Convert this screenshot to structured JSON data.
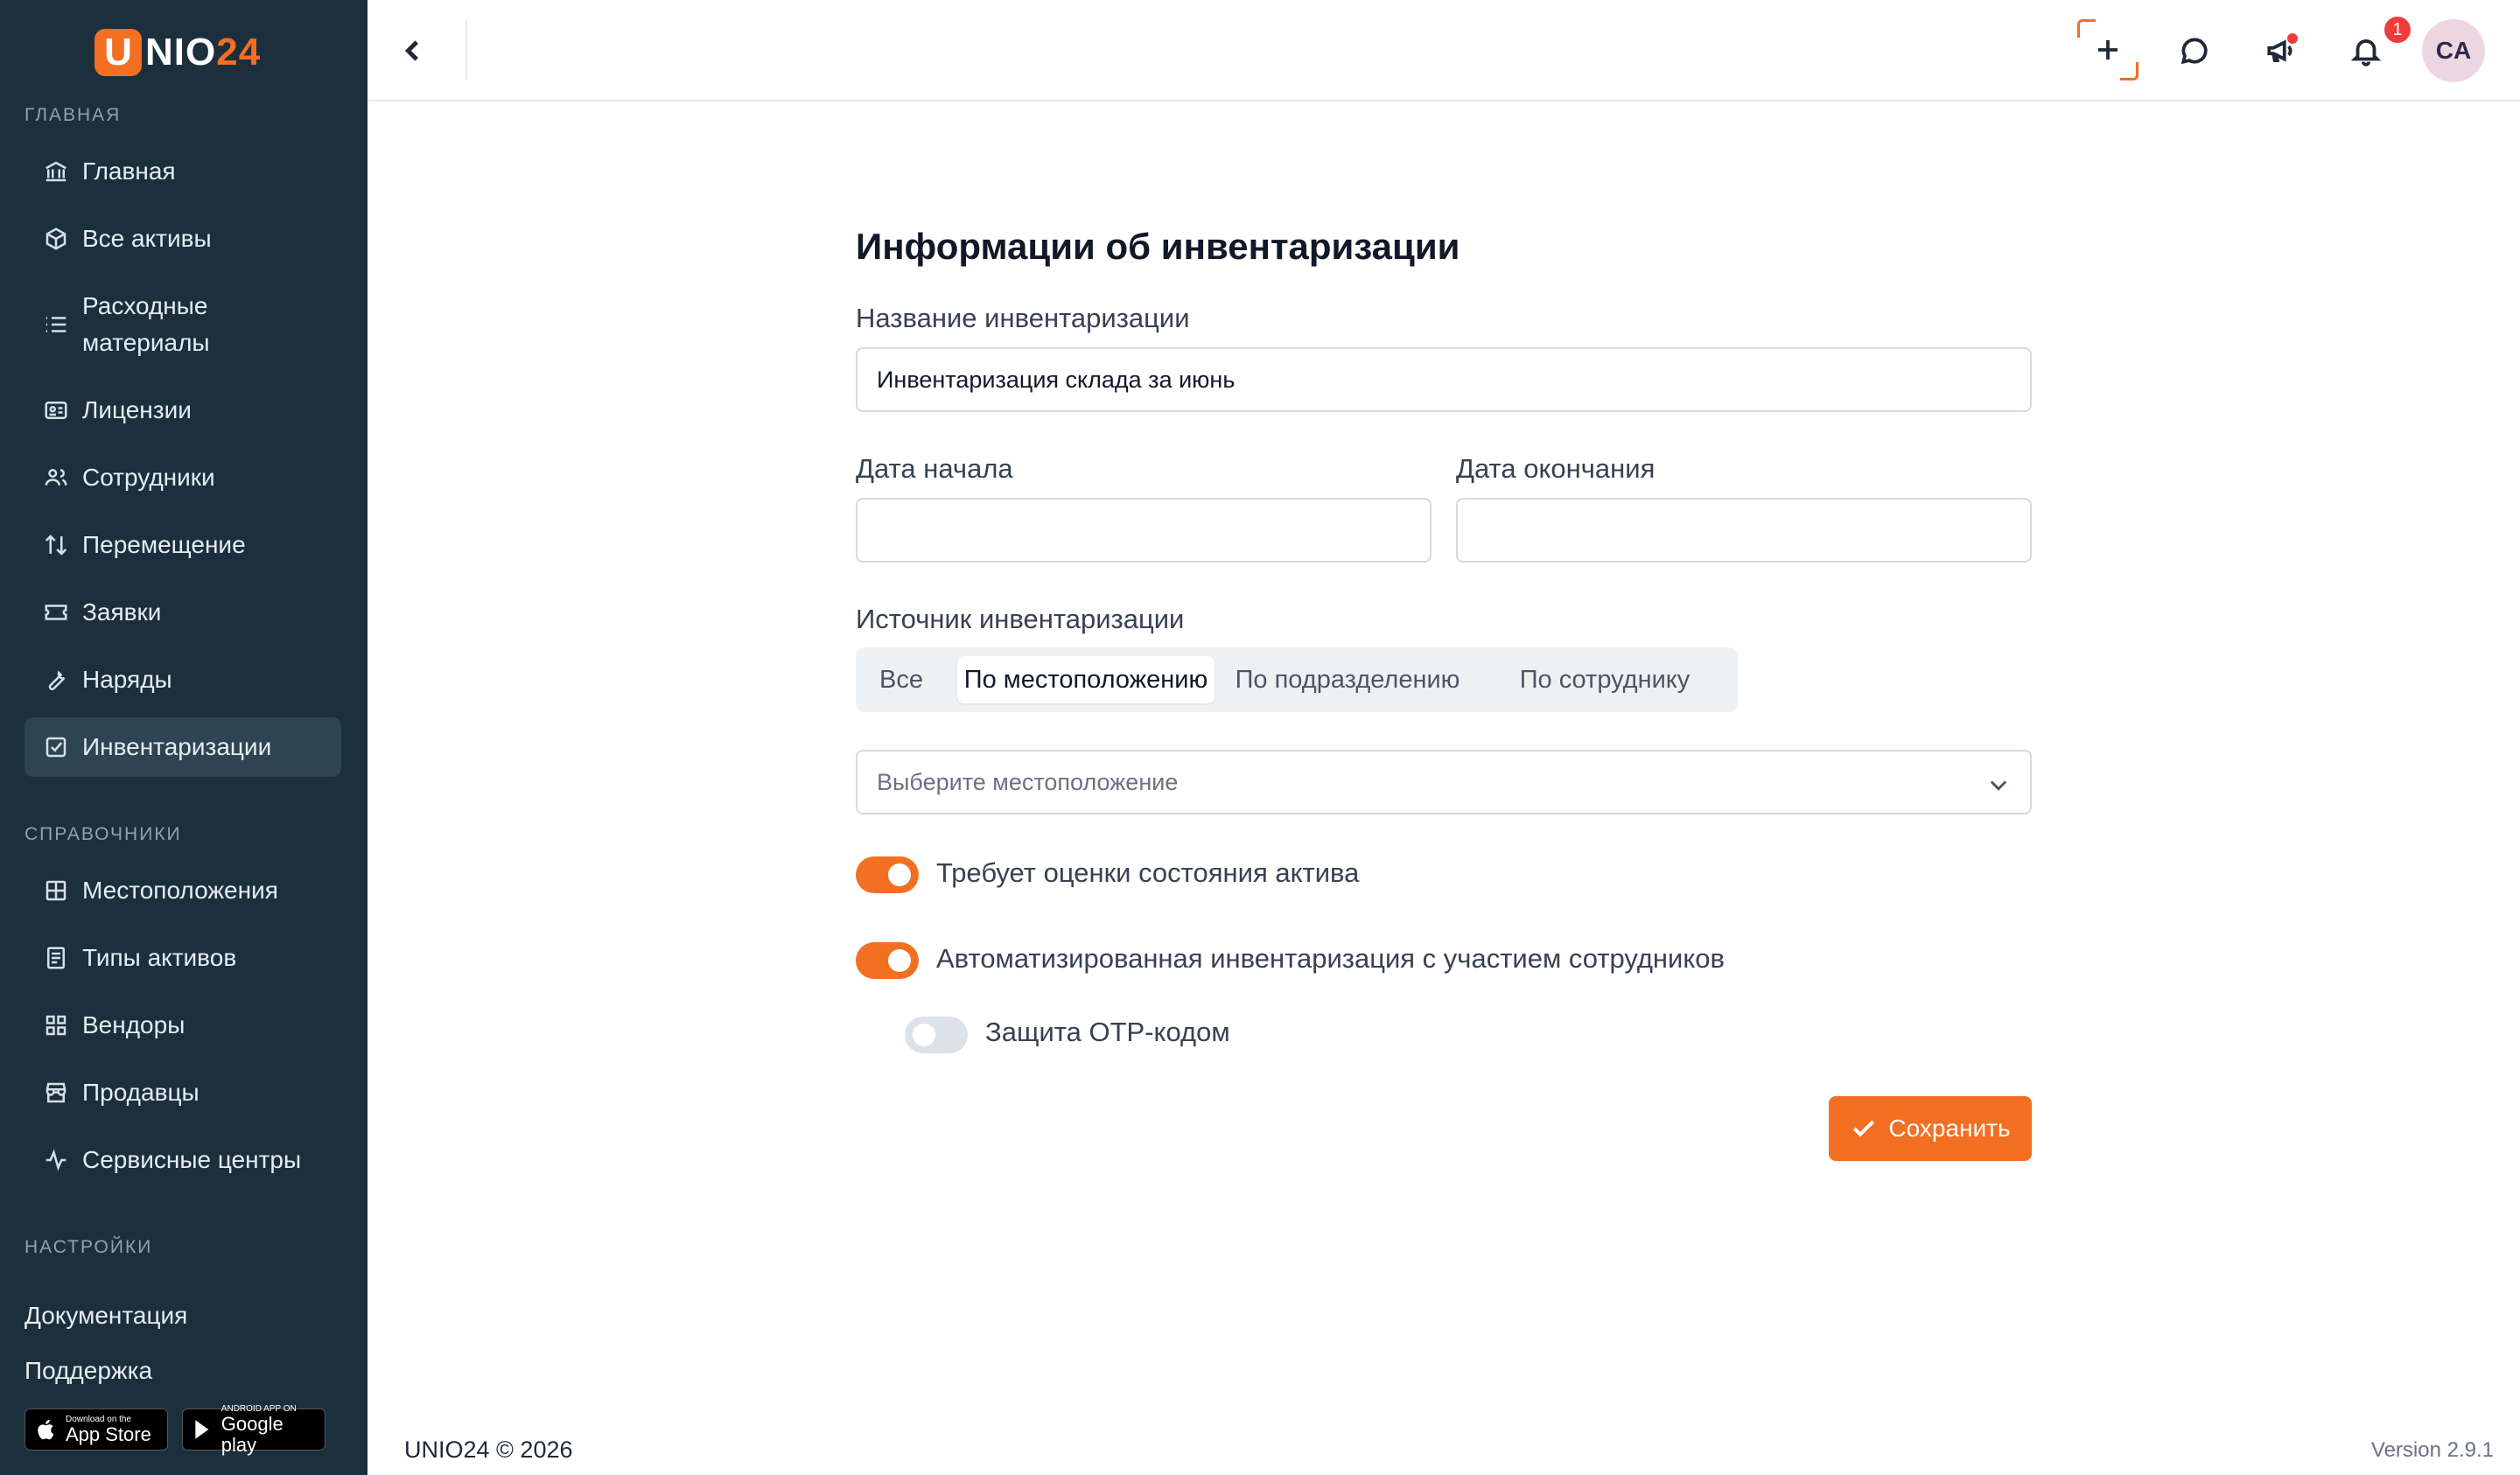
{
  "brand": {
    "logo_letter": "U",
    "logo_white": "NIO",
    "logo_orange": "24",
    "accent": "#f36f21"
  },
  "sidebar": {
    "section_main": "ГЛАВНАЯ",
    "section_refs": "СПРАВОЧНИКИ",
    "section_settings": "НАСТРОЙКИ",
    "main_items": [
      {
        "label": "Главная",
        "icon": "bank-icon"
      },
      {
        "label": "Все активы",
        "icon": "box-icon"
      },
      {
        "label": "Расходные материалы",
        "icon": "list-icon"
      },
      {
        "label": "Лицензии",
        "icon": "id-card-icon"
      },
      {
        "label": "Сотрудники",
        "icon": "users-icon"
      },
      {
        "label": "Перемещение",
        "icon": "arrows-updown-icon"
      },
      {
        "label": "Заявки",
        "icon": "ticket-icon"
      },
      {
        "label": "Наряды",
        "icon": "wrench-icon"
      },
      {
        "label": "Инвентаризации",
        "icon": "checkbox-icon",
        "active": true
      }
    ],
    "ref_items": [
      {
        "label": "Местоположения",
        "icon": "grid-icon"
      },
      {
        "label": "Типы активов",
        "icon": "document-icon"
      },
      {
        "label": "Вендоры",
        "icon": "apps-icon"
      },
      {
        "label": "Продавцы",
        "icon": "store-icon"
      },
      {
        "label": "Сервисные центры",
        "icon": "activity-icon"
      }
    ],
    "documentation": "Документация",
    "support": "Поддержка",
    "app_store": {
      "small": "Download on the",
      "big": "App Store"
    },
    "google_play": {
      "small": "ANDROID APP ON",
      "big": "Google play"
    }
  },
  "header": {
    "notification_count": "1",
    "avatar_initials": "CA"
  },
  "form": {
    "title": "Информации об инвентаризации",
    "name_label": "Название инвентаризации",
    "name_value": "Инвентаризация склада за июнь",
    "start_label": "Дата начала",
    "start_value": "",
    "end_label": "Дата окончания",
    "end_value": "",
    "source_label": "Источник инвентаризации",
    "source_tabs": [
      "Все",
      "По местоположению",
      "По подразделению",
      "По сотруднику"
    ],
    "source_selected": "По местоположению",
    "location_placeholder": "Выберите местоположение",
    "toggle_condition": {
      "label": "Требует оценки состояния актива",
      "on": true
    },
    "toggle_auto": {
      "label": "Автоматизированная инвентаризация с участием сотрудников",
      "on": true
    },
    "toggle_otp": {
      "label": "Защита OTP-кодом",
      "on": false
    },
    "save_label": "Сохранить"
  },
  "footer": {
    "copyright": "UNIO24 © 2026",
    "version": "Version 2.9.1"
  }
}
